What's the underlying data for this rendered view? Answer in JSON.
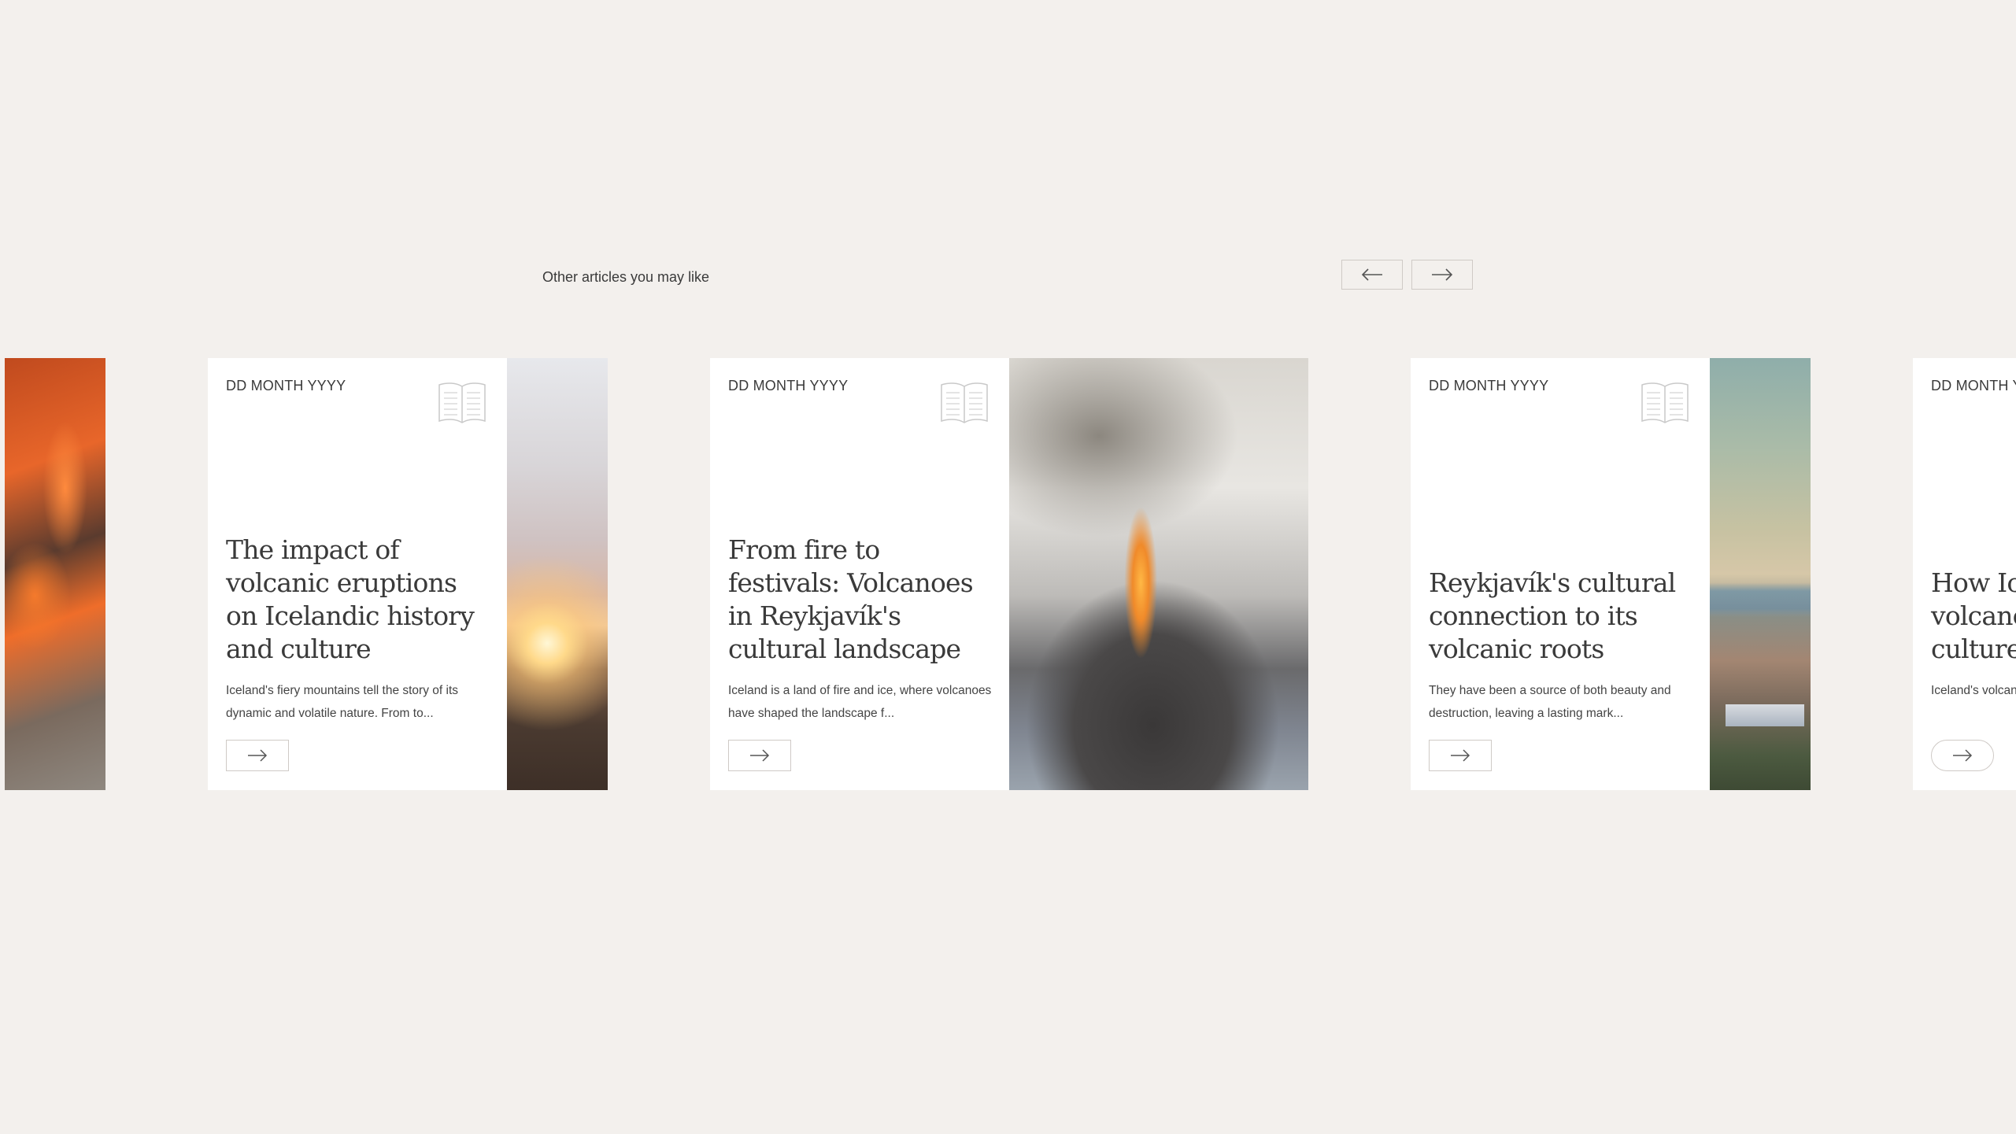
{
  "section": {
    "label": "Other articles you may like",
    "prev_icon": "arrow-left-icon",
    "next_icon": "arrow-right-icon"
  },
  "cards": [
    {
      "date": "DD MONTH YYYY",
      "title": "The impact of volcanic eruptions on Icelandic history and culture",
      "excerpt": "Iceland's fiery mountains tell the story of its dynamic and volatile nature. From to...",
      "image": "sunset-mountains",
      "icon": "open-book-icon"
    },
    {
      "date": "DD MONTH YYYY",
      "title": "From fire to festivals: Volcanoes in Reykjavík's cultural landscape",
      "excerpt": "Iceland is a land of fire and ice, where volcanoes have shaped the landscape f...",
      "image": "erupting-volcano",
      "icon": "open-book-icon"
    },
    {
      "date": "DD MONTH YYYY",
      "title": "Reykjavík's cultural connection to its volcanic roots",
      "excerpt": "They have been a source of both beauty and destruction, leaving a lasting mark...",
      "image": "reykjavik-city",
      "icon": "open-book-icon"
    },
    {
      "date": "DD MONTH YYYY",
      "title": "How Icelandic volcanoes shape its culture",
      "excerpt": "Iceland's volcanoes have been inspiring and f...",
      "image": "",
      "icon": "open-book-icon"
    }
  ],
  "partial_left_card": {
    "image": "lava-flow"
  }
}
